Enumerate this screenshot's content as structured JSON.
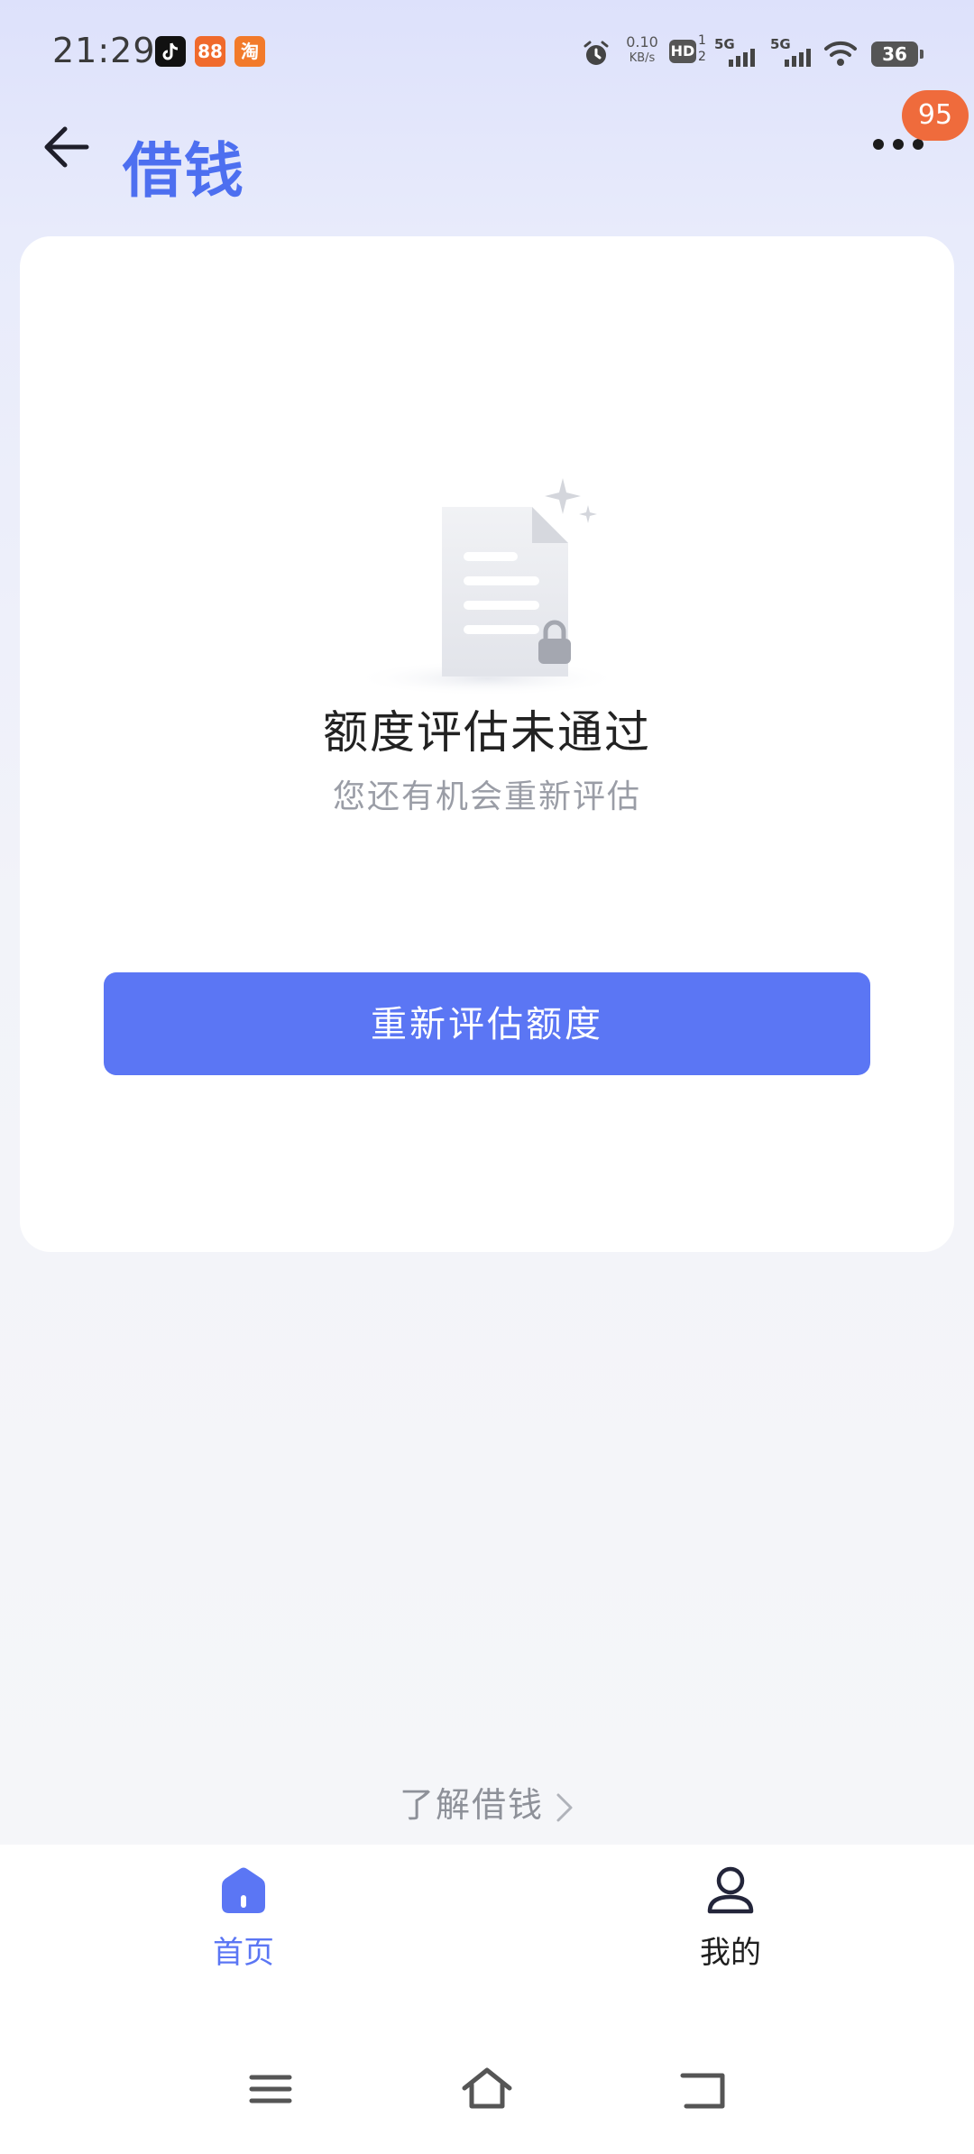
{
  "status_bar": {
    "time": "21:29",
    "speed_value": "0.10",
    "speed_unit": "KB/s",
    "hd_label": "HD",
    "hd_sub_top": "1",
    "hd_sub_bottom": "2",
    "sim1_label": "5G",
    "sim2_label": "5G",
    "battery": "36",
    "app_icons": [
      "tiktok-icon",
      "app-88-icon",
      "taobao-icon"
    ],
    "app_88_label": "88",
    "taobao_label": "淘"
  },
  "header": {
    "title": "借钱",
    "notification_count": "95"
  },
  "card": {
    "status_title": "额度评估未通过",
    "status_subtitle": "您还有机会重新评估",
    "action_label": "重新评估额度"
  },
  "learn_more": {
    "label": "了解借钱"
  },
  "tabbar": {
    "tabs": [
      {
        "label": "首页",
        "active": true
      },
      {
        "label": "我的",
        "active": false
      }
    ]
  },
  "colors": {
    "accent": "#5b76f4",
    "title_blue": "#4d6ff0",
    "badge": "#ef6b3c"
  }
}
